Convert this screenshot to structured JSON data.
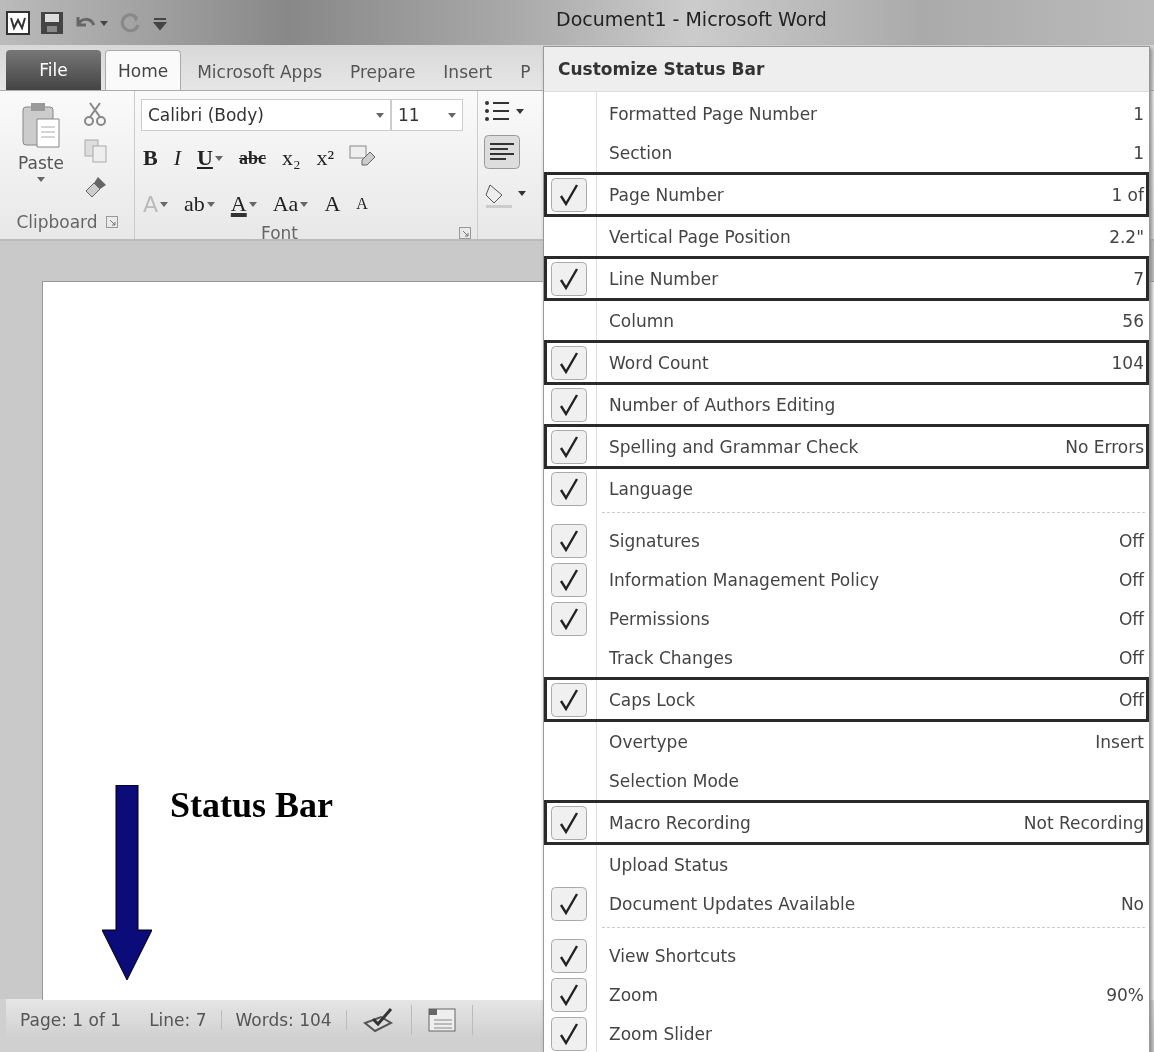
{
  "window": {
    "title": "Document1 - Microsoft Word"
  },
  "tabs": [
    {
      "label": "File",
      "kind": "file",
      "selected": false
    },
    {
      "label": "Home",
      "kind": "tab",
      "selected": true
    },
    {
      "label": "Microsoft Apps",
      "kind": "tab",
      "selected": false
    },
    {
      "label": "Prepare",
      "kind": "tab",
      "selected": false
    },
    {
      "label": "Insert",
      "kind": "tab",
      "selected": false
    },
    {
      "label": "P",
      "kind": "tab",
      "selected": false
    }
  ],
  "ribbon": {
    "clipboard": {
      "paste_label": "Paste",
      "group_label": "Clipboard"
    },
    "font": {
      "font_name": "Calibri (Body)",
      "font_size": "11",
      "group_label": "Font",
      "row1": [
        {
          "label": "B",
          "kind": "bold"
        },
        {
          "label": "I",
          "kind": "italic"
        },
        {
          "label": "U",
          "kind": "underline"
        },
        {
          "label": "abc",
          "kind": "strike"
        },
        {
          "label": "x₂",
          "kind": "plain"
        },
        {
          "label": "x²",
          "kind": "plain"
        }
      ],
      "row2": [
        {
          "label": "A",
          "kind": "effects"
        },
        {
          "label": "ab",
          "kind": "plain"
        },
        {
          "label": "A",
          "kind": "color"
        },
        {
          "label": "Aa",
          "kind": "plain"
        },
        {
          "label": "A",
          "kind": "plain"
        },
        {
          "label": "A",
          "kind": "small"
        }
      ]
    }
  },
  "status_bar": {
    "items": [
      "Page: 1 of 1",
      "Line: 7",
      "Words: 104"
    ]
  },
  "annotation": {
    "label": "Status Bar"
  },
  "menu": {
    "title": "Customize Status Bar",
    "items": [
      {
        "kind": "item",
        "label": "Formatted Page Number",
        "value": "1",
        "checked": false,
        "highlighted": false
      },
      {
        "kind": "item",
        "label": "Section",
        "value": "1",
        "checked": false,
        "highlighted": false
      },
      {
        "kind": "item",
        "label": "Page Number",
        "value": "1 of",
        "checked": true,
        "highlighted": true
      },
      {
        "kind": "item",
        "label": "Vertical Page Position",
        "value": "2.2\"",
        "checked": false,
        "highlighted": false
      },
      {
        "kind": "item",
        "label": "Line Number",
        "value": "7",
        "checked": true,
        "highlighted": true
      },
      {
        "kind": "item",
        "label": "Column",
        "value": "56",
        "checked": false,
        "highlighted": false
      },
      {
        "kind": "item",
        "label": "Word Count",
        "value": "104",
        "checked": true,
        "highlighted": true
      },
      {
        "kind": "item",
        "label": "Number of Authors Editing",
        "checked": true,
        "highlighted": false
      },
      {
        "kind": "item",
        "label": "Spelling and Grammar Check",
        "value": "No Errors",
        "checked": true,
        "highlighted": true
      },
      {
        "kind": "item",
        "label": "Language",
        "checked": true,
        "highlighted": false
      },
      {
        "kind": "separator"
      },
      {
        "kind": "item",
        "label": "Signatures",
        "value": "Off",
        "checked": true,
        "highlighted": false
      },
      {
        "kind": "item",
        "label": "Information Management Policy",
        "value": "Off",
        "checked": true,
        "highlighted": false
      },
      {
        "kind": "item",
        "label": "Permissions",
        "value": "Off",
        "checked": true,
        "highlighted": false
      },
      {
        "kind": "item",
        "label": "Track Changes",
        "value": "Off",
        "checked": false,
        "highlighted": false
      },
      {
        "kind": "item",
        "label": "Caps Lock",
        "value": "Off",
        "checked": true,
        "highlighted": true
      },
      {
        "kind": "item",
        "label": "Overtype",
        "value": "Insert",
        "checked": false,
        "highlighted": false
      },
      {
        "kind": "item",
        "label": "Selection Mode",
        "checked": false,
        "highlighted": false
      },
      {
        "kind": "item",
        "label": "Macro Recording",
        "value": "Not Recording",
        "checked": true,
        "highlighted": true
      },
      {
        "kind": "item",
        "label": "Upload Status",
        "checked": false,
        "highlighted": false
      },
      {
        "kind": "item",
        "label": "Document Updates Available",
        "value": "No",
        "checked": true,
        "highlighted": false
      },
      {
        "kind": "separator"
      },
      {
        "kind": "item",
        "label": "View Shortcuts",
        "checked": true,
        "highlighted": false
      },
      {
        "kind": "item",
        "label": "Zoom",
        "value": "90%",
        "checked": true,
        "highlighted": false
      },
      {
        "kind": "item",
        "label": "Zoom Slider",
        "checked": true,
        "highlighted": false
      }
    ]
  }
}
